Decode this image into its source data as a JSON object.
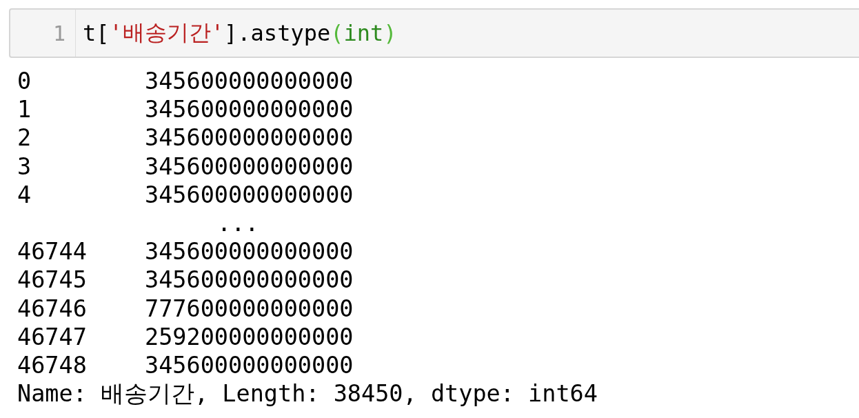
{
  "cell": {
    "line_number": "1",
    "code": [
      {
        "kind": "plain",
        "text": "t["
      },
      {
        "kind": "string",
        "text": "'배송기간'"
      },
      {
        "kind": "plain",
        "text": "].astype"
      },
      {
        "kind": "paren",
        "text": "("
      },
      {
        "kind": "builtin",
        "text": "int"
      },
      {
        "kind": "paren",
        "text": ")"
      }
    ]
  },
  "output": {
    "rows": [
      {
        "kind": "row",
        "index": "0",
        "value": "345600000000000"
      },
      {
        "kind": "row",
        "index": "1",
        "value": "345600000000000"
      },
      {
        "kind": "row",
        "index": "2",
        "value": "345600000000000"
      },
      {
        "kind": "row",
        "index": "3",
        "value": "345600000000000"
      },
      {
        "kind": "row",
        "index": "4",
        "value": "345600000000000"
      },
      {
        "kind": "ellipsis",
        "value": "..."
      },
      {
        "kind": "row",
        "index": "46744",
        "value": "345600000000000"
      },
      {
        "kind": "row",
        "index": "46745",
        "value": "345600000000000"
      },
      {
        "kind": "row",
        "index": "46746",
        "value": "777600000000000"
      },
      {
        "kind": "row",
        "index": "46747",
        "value": "259200000000000"
      },
      {
        "kind": "row",
        "index": "46748",
        "value": "345600000000000"
      }
    ],
    "footer": "Name: 배송기간, Length: 38450, dtype: int64"
  }
}
